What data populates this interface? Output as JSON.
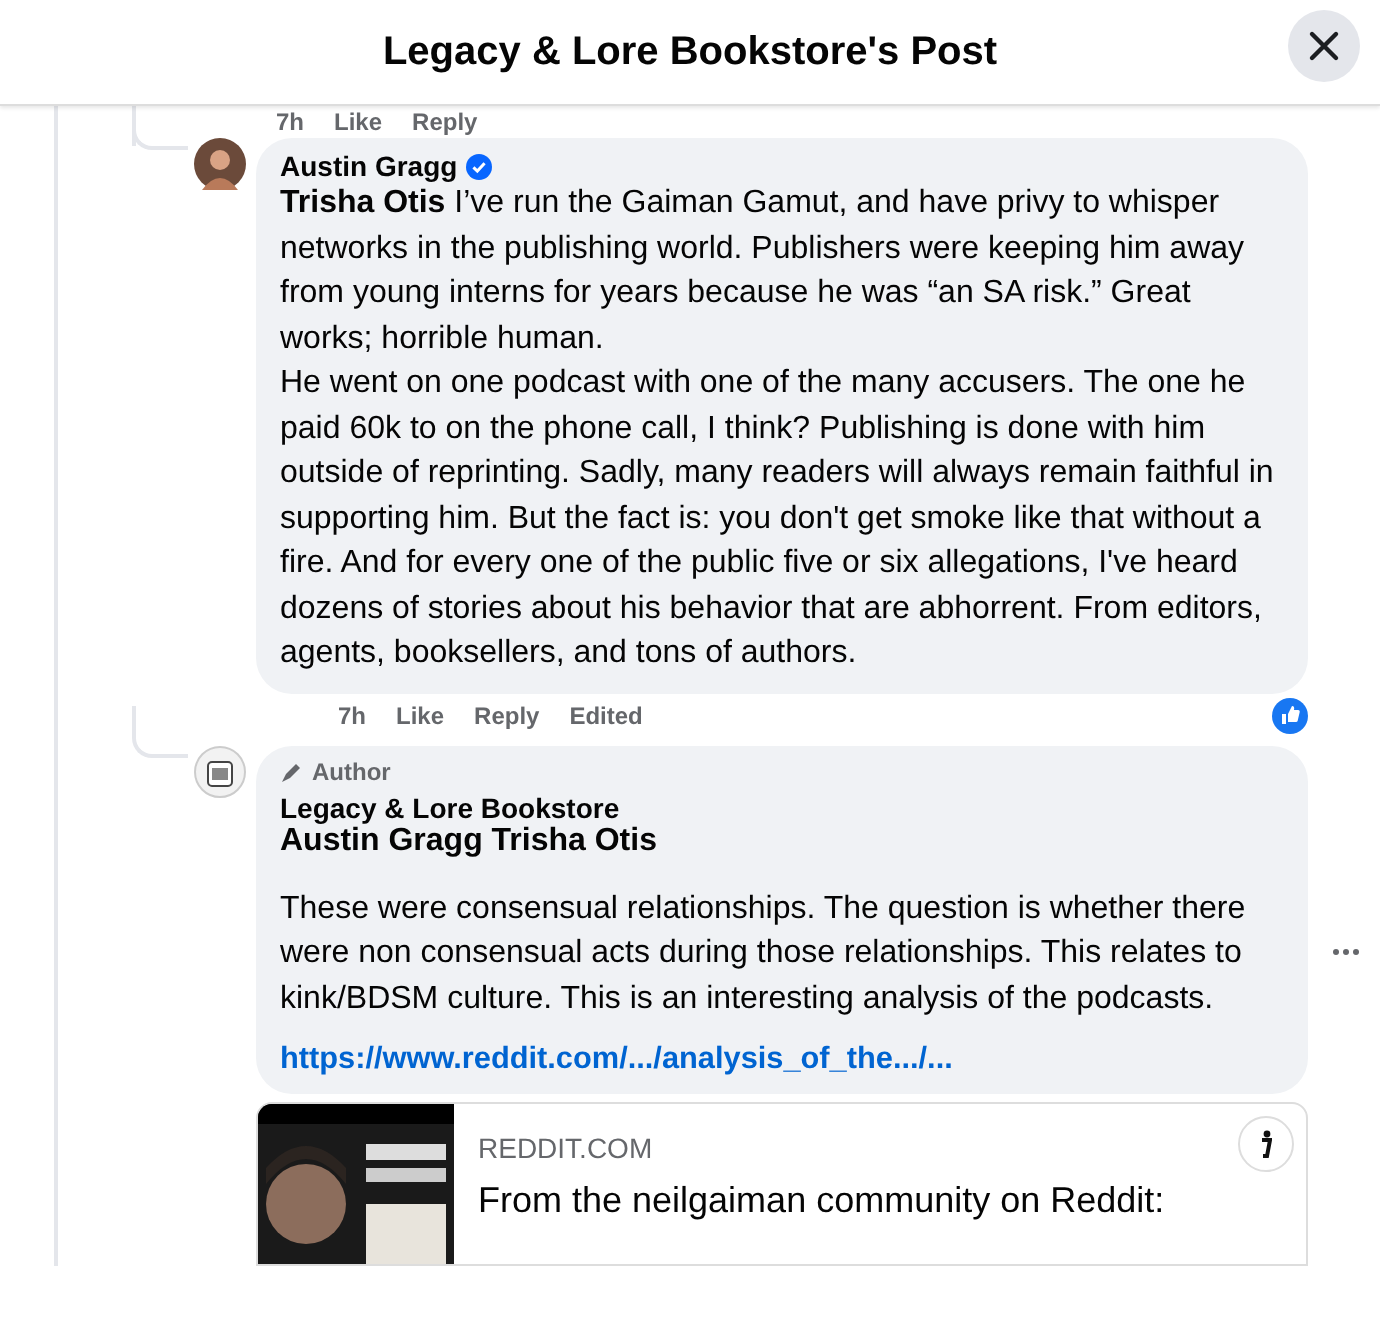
{
  "header": {
    "title": "Legacy & Lore Bookstore's Post"
  },
  "previous_actions": [
    "7h",
    "Like",
    "Reply"
  ],
  "comments": [
    {
      "kind": "reply",
      "author": "Austin Gragg",
      "verified": true,
      "paragraphs": [
        "**Trisha Otis** I’ve run the Gaiman Gamut, and have privy to whisper networks in the publishing world. Publishers were keeping him away from young interns for years because he was “an SA risk.” Great works; horrible human.",
        "He went on one podcast with one of the many accusers. The one he paid 60k to on the phone call, I think? Publishing is done with him outside of reprinting. Sadly, many readers will always remain faithful in supporting him. But the fact is: you don't get smoke like that without a fire. And for every one of the public five or six allegations, I've heard dozens of stories about his behavior that are abhorrent. From editors, agents, booksellers, and tons of authors."
      ],
      "actions": [
        "7h",
        "Like",
        "Reply",
        "Edited"
      ],
      "liked": true
    },
    {
      "kind": "author",
      "author": "Austin Gragg Trisha Otis",
      "verified": false,
      "author_badge": "Author",
      "page_name": "Legacy & Lore Bookstore",
      "paragraphs": [
        "These were consensual relationships. The question is whether there were non consensual acts during those relationships. This relates to kink/BDSM culture. This is an interesting analysis of the podcasts."
      ],
      "link": "https://www.reddit.com/.../analysis_of_the.../...",
      "preview": {
        "domain": "REDDIT.COM",
        "title": "From the neilgaiman community on Reddit:"
      }
    }
  ]
}
